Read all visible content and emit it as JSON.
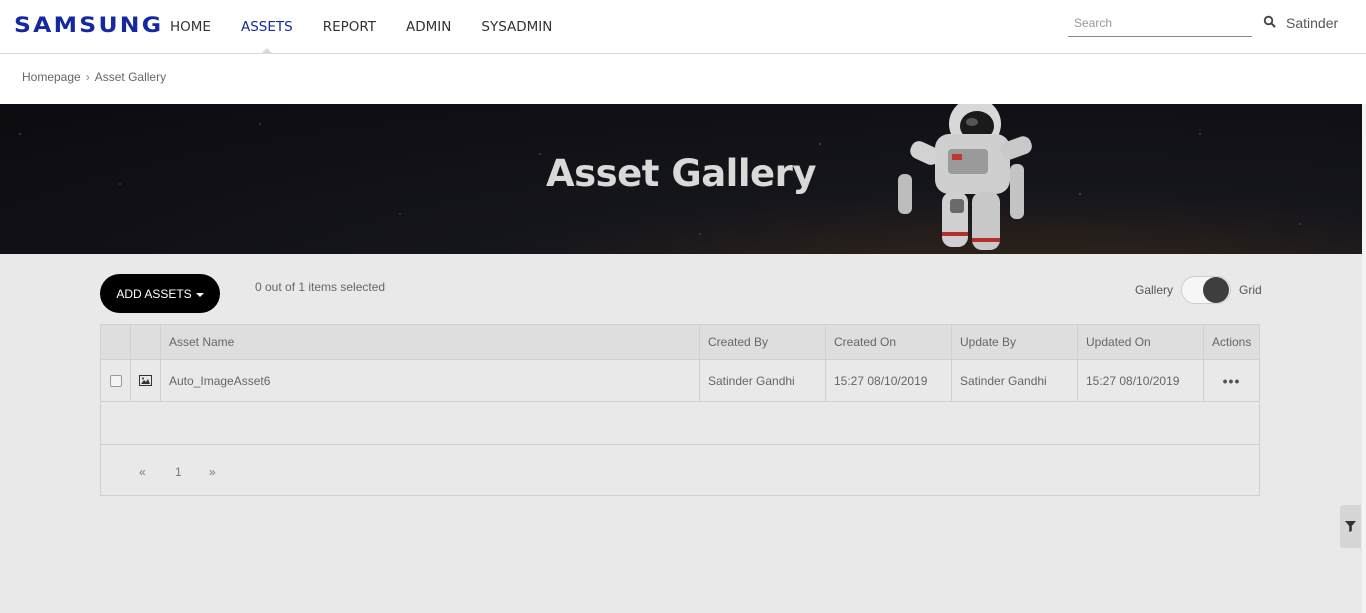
{
  "brand": {
    "logo": "SAMSUNG",
    "color": "#1428a0"
  },
  "nav": {
    "items": [
      {
        "label": "HOME",
        "active": false
      },
      {
        "label": "ASSETS",
        "active": true
      },
      {
        "label": "REPORT",
        "active": false
      },
      {
        "label": "ADMIN",
        "active": false
      },
      {
        "label": "SYSADMIN",
        "active": false
      }
    ]
  },
  "search": {
    "placeholder": "Search",
    "value": "",
    "icon": "search-icon"
  },
  "user": {
    "name": "Satinder"
  },
  "breadcrumb": {
    "items": [
      "Homepage",
      "Asset Gallery"
    ],
    "separator": "›"
  },
  "banner": {
    "title": "Asset Gallery"
  },
  "toolbar": {
    "add_assets_label": "ADD ASSETS",
    "selected_text": "0 out of 1 items selected",
    "view_left_label": "Gallery",
    "view_right_label": "Grid",
    "view_selected": "Grid"
  },
  "table": {
    "columns": [
      "Asset Name",
      "Created By",
      "Created On",
      "Update By",
      "Updated On",
      "Actions"
    ],
    "rows": [
      {
        "asset_name": "Auto_ImageAsset6",
        "created_by": "Satinder Gandhi",
        "created_on": "15:27 08/10/2019",
        "update_by": "Satinder Gandhi",
        "updated_on": "15:27 08/10/2019",
        "actions": "•••",
        "checked": false,
        "thumb_icon": "image-icon"
      }
    ]
  },
  "pagination": {
    "prev": "«",
    "page": "1",
    "next": "»"
  },
  "filter": {
    "icon": "filter-icon"
  }
}
